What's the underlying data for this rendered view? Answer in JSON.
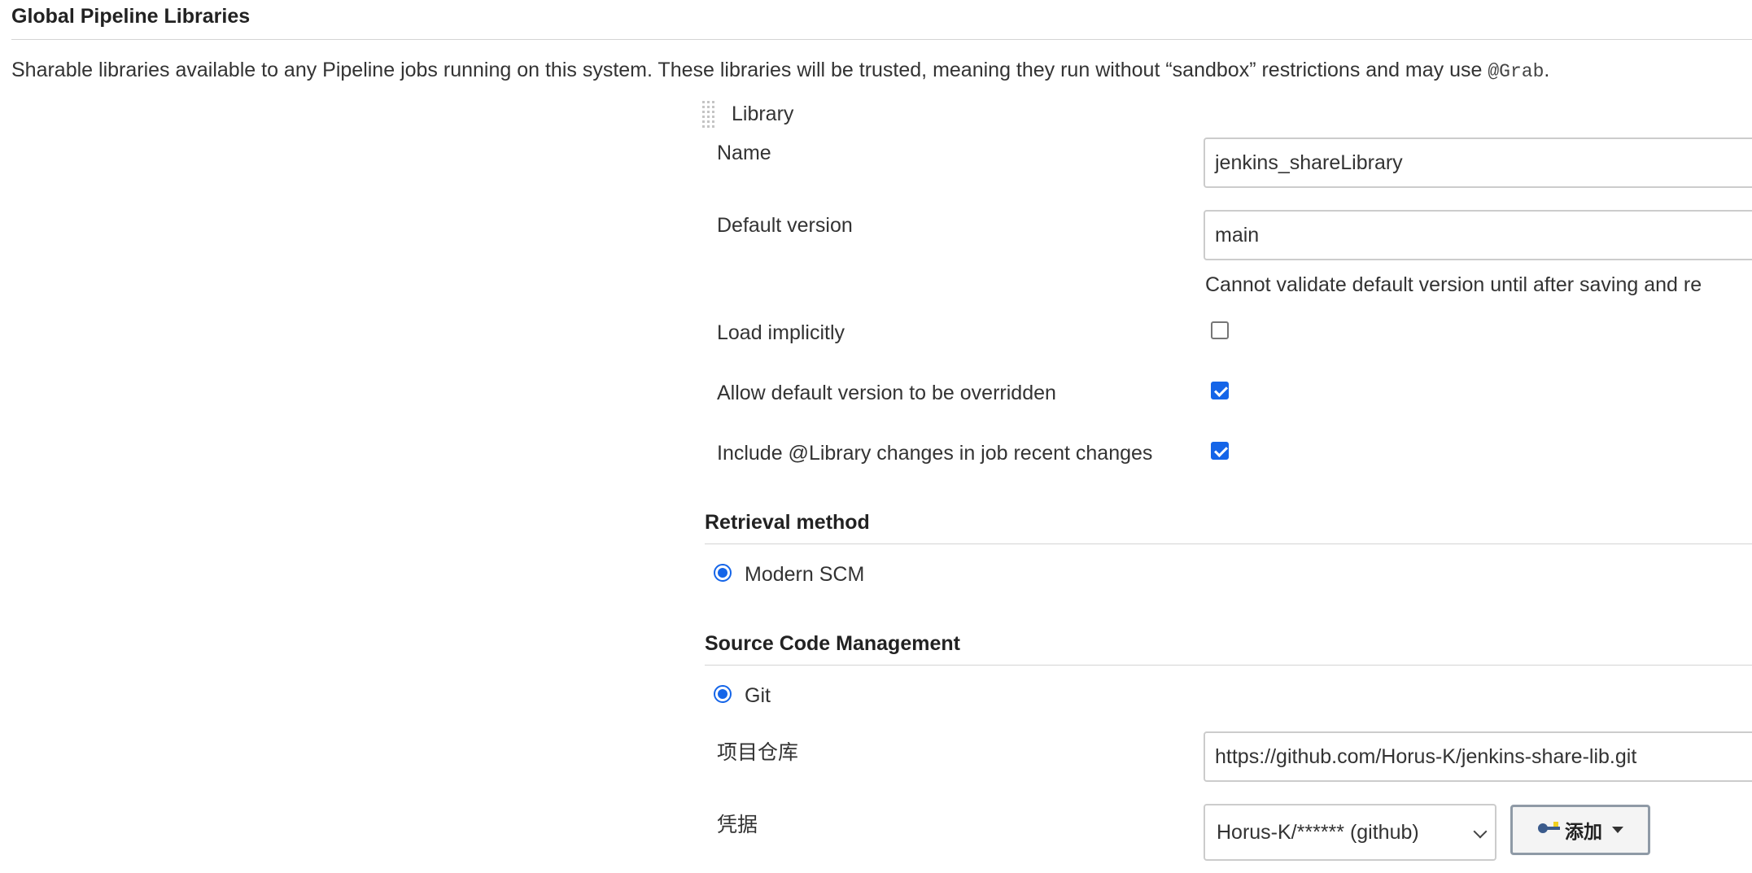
{
  "section": {
    "title": "Global Pipeline Libraries",
    "description": "Sharable libraries available to any Pipeline jobs running on this system. These libraries will be trusted, meaning they run without “sandbox” restrictions and may use ",
    "description_code": "@Grab",
    "description_end": "."
  },
  "library": {
    "header": "Library",
    "name_label": "Name",
    "name_value": "jenkins_shareLibrary",
    "default_version_label": "Default version",
    "default_version_value": "main",
    "default_version_note": "Cannot validate default version until after saving and re",
    "load_implicitly_label": "Load implicitly",
    "load_implicitly_checked": false,
    "allow_override_label": "Allow default version to be overridden",
    "allow_override_checked": true,
    "include_changes_label": "Include @Library changes in job recent changes",
    "include_changes_checked": true
  },
  "retrieval": {
    "title": "Retrieval method",
    "option_label": "Modern SCM"
  },
  "scm": {
    "title": "Source Code Management",
    "option_label": "Git",
    "repo_label": "项目仓库",
    "repo_value": "https://github.com/Horus-K/jenkins-share-lib.git",
    "credentials_label": "凭据",
    "credentials_value": "Horus-K/****** (github)",
    "add_button_label": "添加",
    "key_icon": "key-icon"
  },
  "colors": {
    "accent": "#1565e8",
    "border": "#cccccc"
  }
}
